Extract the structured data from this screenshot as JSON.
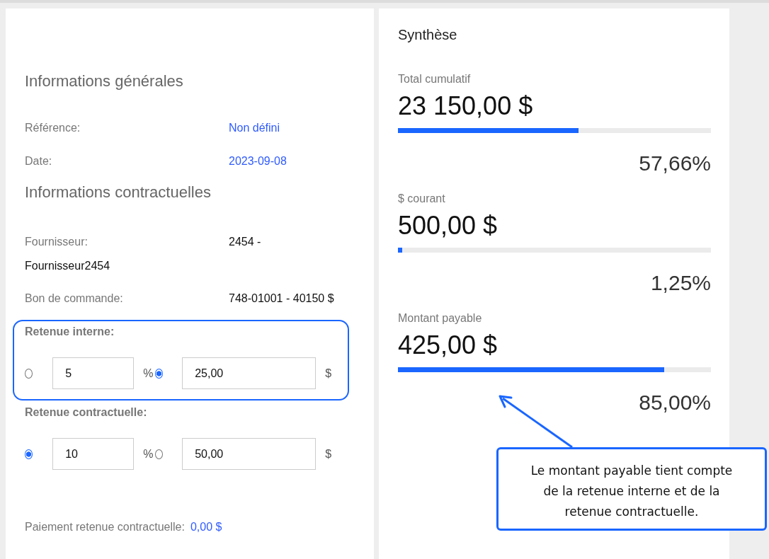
{
  "general": {
    "title": "Informations générales",
    "fields": [
      {
        "label": "Référence:",
        "value": "Non défini",
        "kind": "link"
      },
      {
        "label": "Date:",
        "value": "2023-09-08",
        "kind": "link"
      }
    ]
  },
  "contract": {
    "title": "Informations contractuelles",
    "fields": [
      {
        "label": "Fournisseur:",
        "value": "2454 -",
        "continuation": "Fournisseur2454",
        "kind": "wrapped"
      },
      {
        "label": "Bon de commande:",
        "value": "748-01001 - 40150 $",
        "kind": "text"
      }
    ]
  },
  "retentions": [
    {
      "title": "Retenue interne:",
      "highlighted": true,
      "options": [
        {
          "selected": false,
          "value": "5",
          "unit": "%"
        },
        {
          "selected": true,
          "value": "25,00",
          "unit": "$"
        }
      ]
    },
    {
      "title": "Retenue contractuelle:",
      "highlighted": false,
      "options": [
        {
          "selected": true,
          "value": "10",
          "unit": "%"
        },
        {
          "selected": false,
          "value": "50,00",
          "unit": "$"
        }
      ]
    }
  ],
  "payment": {
    "label": "Paiement retenue contractuelle:",
    "value": "0,00 $"
  },
  "summary": {
    "title": "Synthèse",
    "metrics": [
      {
        "label": "Total cumulatif",
        "amount": "23 150,00 $",
        "level": 0.5766,
        "percent": "57,66%"
      },
      {
        "label": "$ courant",
        "amount": "500,00 $",
        "level": 0.0125,
        "percent": "1,25%"
      },
      {
        "label": "Montant payable",
        "amount": "425,00 $",
        "level": 0.85,
        "percent": "85,00%"
      }
    ]
  },
  "callout": {
    "text": "Le montant payable tient compte de la retenue interne et de la retenue contractuelle."
  }
}
